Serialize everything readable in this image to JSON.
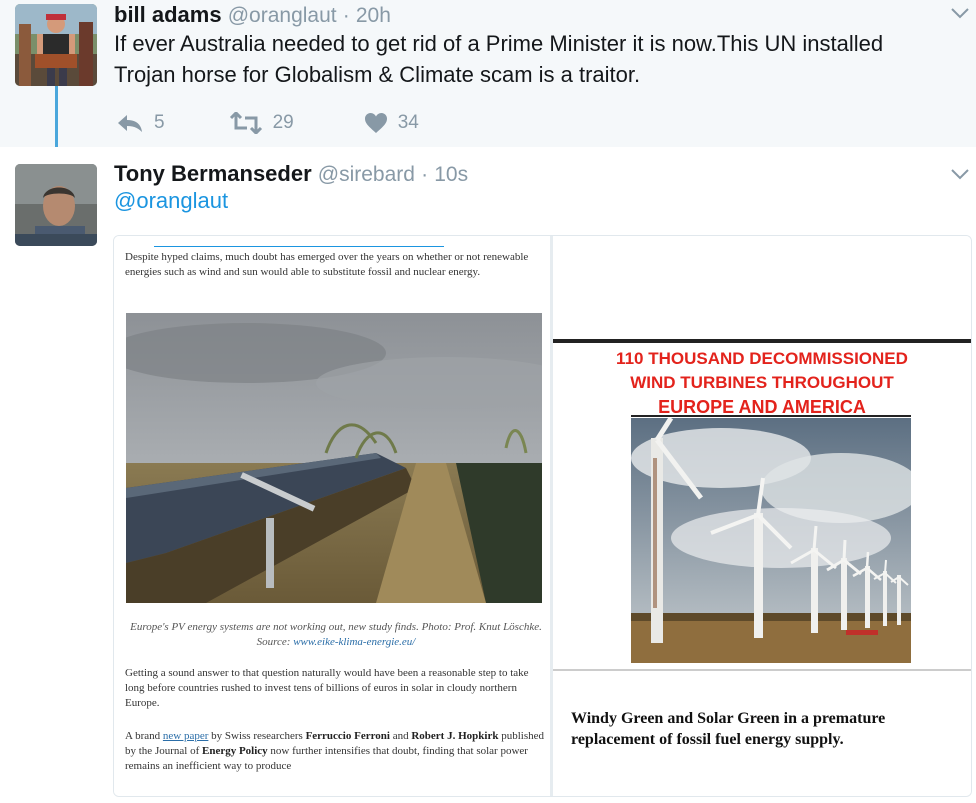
{
  "tweets": [
    {
      "name": "bill adams",
      "handle": "@oranglaut",
      "separator": "·",
      "time": "20h",
      "text_line1": "If ever Australia needed to get rid of a Prime Minister it is now.This UN installed",
      "text_line2": "Trojan horse for Globalism & Climate scam is a traitor.",
      "replies": "5",
      "retweets": "29",
      "likes": "34"
    },
    {
      "name": "Tony Bermanseder",
      "handle": "@sirebard",
      "separator": "·",
      "time": "10s",
      "mention": "@oranglaut"
    }
  ],
  "article": {
    "intro": "Despite hyped claims, much doubt has emerged over the years on whether or not renewable energies such as wind and sun would able to substitute fossil and nuclear energy.",
    "caption_text": "Europe's PV energy systems are not working out, new study finds. Photo: Prof. Knut Löschke. Source: ",
    "caption_link": "www.eike-klima-energie.eu/",
    "body1": "Getting a sound answer to that question naturally would have been a reasonable step to take long before countries rushed to invest tens of billions of euros in solar in cloudy northern Europe.",
    "body2_a": "A brand ",
    "body2_link": "new paper",
    "body2_b": " by Swiss researchers ",
    "body2_name1": "Ferruccio Ferroni",
    "body2_c": " and ",
    "body2_name2": "Robert J. Hopkirk",
    "body2_d": " published by the Journal of ",
    "body2_journal": "Energy Policy",
    "body2_e": " now further intensifies that doubt, finding that solar power remains an inefficient way to produce"
  },
  "meme": {
    "line1": "110 THOUSAND  DECOMMISSIONED",
    "line2": "WIND TURBINES THROUGHOUT",
    "line3": "EUROPE AND AMERICA",
    "caption": "Windy Green and Solar Green in a premature replacement of fossil fuel energy supply."
  },
  "colors": {
    "link": "#1b95e0",
    "muted": "#8899a6",
    "thread_line": "#4aa7dc",
    "meme_red": "#e3231c"
  },
  "icons": [
    "reply-icon",
    "retweet-icon",
    "like-icon",
    "chevron-down-icon"
  ]
}
